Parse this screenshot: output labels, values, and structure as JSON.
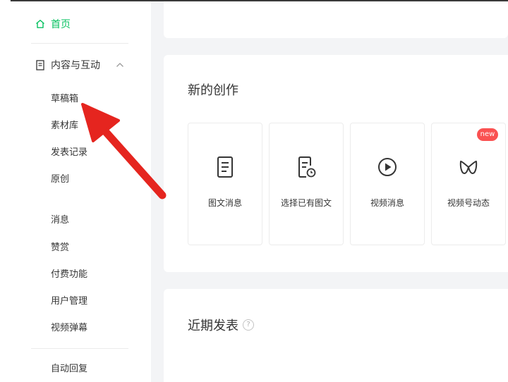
{
  "sidebar": {
    "home": {
      "label": "首页",
      "icon": "home-icon",
      "color": "#07c160"
    },
    "section": {
      "label": "内容与互动",
      "icon": "document-icon",
      "expanded": true
    },
    "content_items": [
      {
        "label": "草稿箱"
      },
      {
        "label": "素材库"
      },
      {
        "label": "发表记录"
      },
      {
        "label": "原创"
      }
    ],
    "more_items": [
      {
        "label": "消息"
      },
      {
        "label": "赞赏"
      },
      {
        "label": "付费功能"
      },
      {
        "label": "用户管理"
      },
      {
        "label": "视频弹幕"
      }
    ],
    "bottom_items": [
      {
        "label": "自动回复"
      }
    ]
  },
  "create": {
    "title": "新的创作",
    "tiles": [
      {
        "label": "图文消息",
        "icon": "article-icon"
      },
      {
        "label": "选择已有图文",
        "icon": "existing-article-icon"
      },
      {
        "label": "视频消息",
        "icon": "play-icon"
      },
      {
        "label": "视频号动态",
        "icon": "channels-icon",
        "badge": "new"
      }
    ]
  },
  "recent": {
    "title": "近期发表",
    "help_icon": "?"
  },
  "annotation": {
    "type": "arrow",
    "color": "#e5251f"
  },
  "colors": {
    "accent": "#07c160",
    "badge": "#fa5151",
    "background": "#f3f4f6"
  }
}
